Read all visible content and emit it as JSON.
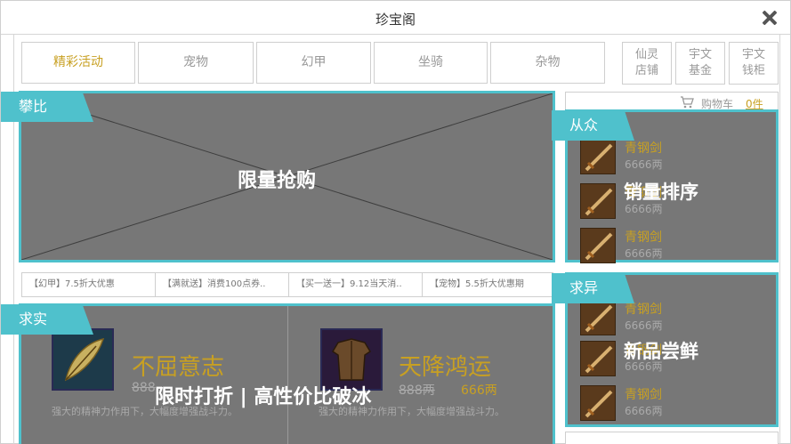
{
  "window": {
    "title": "珍宝阁"
  },
  "tabs": [
    {
      "label": "精彩活动",
      "active": true
    },
    {
      "label": "宠物",
      "active": false
    },
    {
      "label": "幻甲",
      "active": false
    },
    {
      "label": "坐骑",
      "active": false
    },
    {
      "label": "杂物",
      "active": false
    }
  ],
  "side_buttons": [
    {
      "line1": "仙灵",
      "line2": "店铺"
    },
    {
      "line1": "宇文",
      "line2": "基金"
    },
    {
      "line1": "宇文",
      "line2": "钱柜"
    }
  ],
  "flash_sale": {
    "ribbon": "攀比",
    "overlay": "限量抢购"
  },
  "news": [
    "【幻甲】7.5折大优惠",
    "【满就送】消费100点券..",
    "【买一送一】9.12当天消..",
    "【宠物】5.5折大优惠期"
  ],
  "cart": {
    "label": "购物车",
    "count": "0件"
  },
  "bestseller": {
    "ribbon": "从众",
    "overlay": "销量排序",
    "items": [
      {
        "name": "青钢剑",
        "price": "6666两"
      },
      {
        "name": "青钢剑",
        "price": "6666两"
      },
      {
        "name": "青钢剑",
        "price": "6666两"
      }
    ]
  },
  "new_items": {
    "ribbon": "求异",
    "overlay": "新品尝鲜",
    "items": [
      {
        "name": "青钢剑",
        "price": "6666两"
      },
      {
        "name": "青钢剑",
        "price": "6666两"
      },
      {
        "name": "青钢剑",
        "price": "6666两"
      }
    ]
  },
  "discount": {
    "ribbon": "求实",
    "overlay": "限时打折 | 高性价比破冰",
    "deals": [
      {
        "name": "不屈意志",
        "orig": "888",
        "price": "",
        "desc": "强大的精神力作用下，大幅度增强战斗力。"
      },
      {
        "name": "天降鸿运",
        "orig": "888两",
        "price": "666两",
        "desc": "强大的精神力作用下，大幅度增强战斗力。"
      }
    ]
  },
  "colors": {
    "accent": "#4fc1cc",
    "gold": "#c8a022",
    "overlay_gray": "#777777"
  },
  "icons": {
    "close": "close-icon",
    "cart": "cart-icon",
    "sword": "sword-icon",
    "feather": "feather-icon",
    "armor": "armor-icon"
  }
}
